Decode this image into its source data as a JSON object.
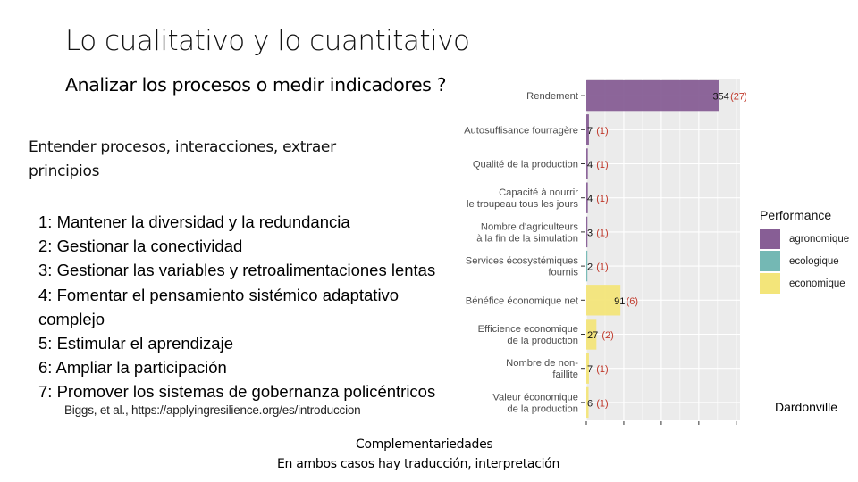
{
  "slide": {
    "title": "Lo cualitativo y lo cuantitativo",
    "subtitle": "Analizar los procesos o medir indicadores ?",
    "intro": "Entender procesos, interacciones, extraer principios",
    "principles": [
      "1: Mantener la diversidad y la redundancia",
      "2: Gestionar la conectividad",
      "3: Gestionar las variables y retroalimentaciones lentas",
      "4: Fomentar el pensamiento sistémico adaptativo complejo",
      "5: Estimular el aprendizaje",
      "6: Ampliar la participación",
      "7: Promover los sistemas de gobernanza policéntricos"
    ],
    "citation": "Biggs, et al., https://applyingresilience.org/es/introduccion",
    "footer_line1": "Complementariedades",
    "footer_line2": "En ambos casos hay traducción, interpretación",
    "credit": "Dardonville"
  },
  "chart_data": {
    "type": "bar",
    "orientation": "horizontal",
    "title": "",
    "xlabel": "",
    "ylabel": "",
    "xlim": [
      0,
      410
    ],
    "x_ticks": [
      0,
      100,
      200,
      300,
      400
    ],
    "x_tick_labels_visible": false,
    "grid": true,
    "legend": {
      "title": "Performance",
      "position": "right",
      "entries": [
        {
          "name": "agronomique",
          "color": "#875E95"
        },
        {
          "name": "ecologique",
          "color": "#74B8B4"
        },
        {
          "name": "economique",
          "color": "#F3E57A"
        }
      ]
    },
    "categories": [
      "Rendement",
      "Autosuffisance fourragère",
      "Qualité de la production",
      "Capacité à nourrir\nle troupeau tous les jours",
      "Nombre d'agriculteurs\nà la fin de la simulation",
      "Services écosystémiques\nfournis",
      "Bénéfice économique net",
      "Efficience economique\nde la production",
      "Nombre de non-\nfaillite",
      "Valeur économique\nde la production"
    ],
    "values": [
      354,
      7,
      4,
      4,
      3,
      2,
      91,
      27,
      7,
      6
    ],
    "counts": [
      27,
      1,
      1,
      1,
      1,
      1,
      6,
      2,
      1,
      1
    ],
    "groups": [
      "agronomique",
      "agronomique",
      "agronomique",
      "agronomique",
      "agronomique",
      "ecologique",
      "economique",
      "economique",
      "economique",
      "economique"
    ],
    "colors": {
      "panel_bg": "#EBEBEB",
      "grid": "#FFFFFF",
      "value_label": "#111111",
      "count_label": "#C0392B",
      "axis_text": "#4D4D4D"
    }
  }
}
